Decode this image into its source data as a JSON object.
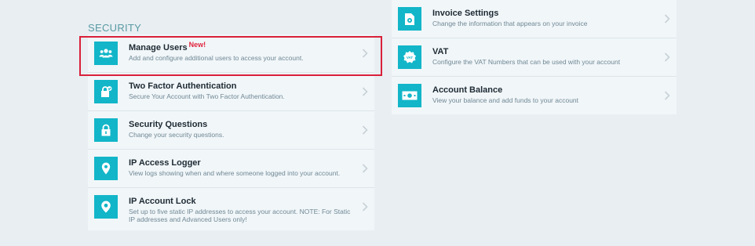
{
  "security": {
    "heading": "SECURITY",
    "items": [
      {
        "title": "Manage Users",
        "badge": "New!",
        "desc": "Add and configure additional users to access your account.",
        "icon": "users-icon"
      },
      {
        "title": "Two Factor Authentication",
        "desc": "Secure Your Account with Two Factor Authentication.",
        "icon": "lock-check-icon"
      },
      {
        "title": "Security Questions",
        "desc": "Change your security questions.",
        "icon": "padlock-icon"
      },
      {
        "title": "IP Access Logger",
        "desc": "View logs showing when and where someone logged into your account.",
        "icon": "location-pin-icon"
      },
      {
        "title": "IP Account Lock",
        "desc": "Set up to five static IP addresses to access your account. NOTE: For Static IP addresses and Advanced Users only!",
        "icon": "location-pin-icon"
      }
    ]
  },
  "billing": {
    "items": [
      {
        "title": "Invoice Settings",
        "desc": "Change the information that appears on your invoice",
        "icon": "invoice-gear-icon"
      },
      {
        "title": "VAT",
        "desc": "Configure the VAT Numbers that can be used with your account",
        "icon": "vat-badge-icon",
        "icon_text": "VAT"
      },
      {
        "title": "Account Balance",
        "desc": "View your balance and add funds to your account",
        "icon": "banknote-icon"
      }
    ]
  },
  "colors": {
    "accent": "#12b6c8",
    "highlight": "#d9203a",
    "badge": "#e0233c"
  }
}
